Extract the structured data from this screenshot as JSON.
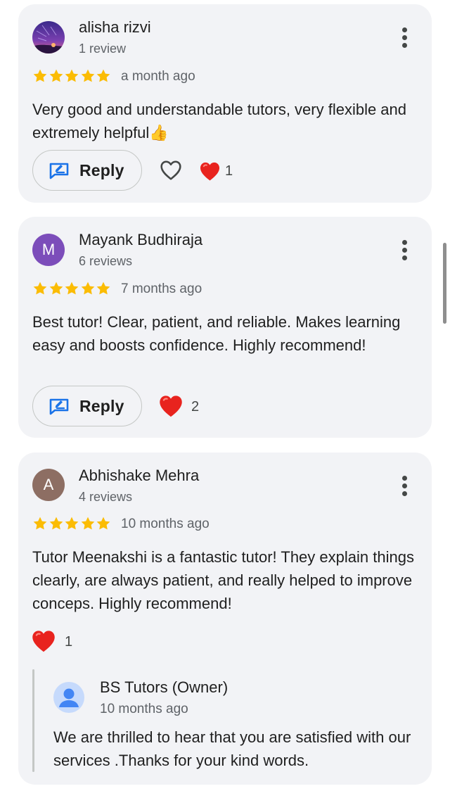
{
  "reviews": [
    {
      "author": "alisha rizvi",
      "review_count": "1 review",
      "rating": 5,
      "date": "a month ago",
      "text": "Very good and understandable tutors, very flexible and extremely helpful👍",
      "reply_label": "Reply",
      "heart_count": "1"
    },
    {
      "author": "Mayank Budhiraja",
      "avatar_letter": "M",
      "avatar_color": "#7c4dba",
      "review_count": "6 reviews",
      "rating": 5,
      "date": "7 months ago",
      "text": "Best tutor! Clear, patient, and reliable. Makes learning easy and boosts confidence. Highly recommend!",
      "reply_label": "Reply",
      "heart_count": "2"
    },
    {
      "author": "Abhishake Mehra",
      "avatar_letter": "A",
      "avatar_color": "#8d6e63",
      "review_count": "4 reviews",
      "rating": 5,
      "date": "10 months ago",
      "text": "Tutor Meenakshi is a fantastic tutor! They explain things clearly, are always patient, and really helped to improve conceps. Highly recommend!",
      "heart_count": "1",
      "owner_reply": {
        "name": "BS Tutors (Owner)",
        "date": "10 months ago",
        "text": "We are thrilled to hear that you are satisfied with our services .Thanks for your kind words."
      }
    }
  ],
  "colors": {
    "star": "#fbbc04",
    "heart": "#e8231e",
    "accent": "#1a73e8",
    "card_bg": "#f2f3f6"
  }
}
